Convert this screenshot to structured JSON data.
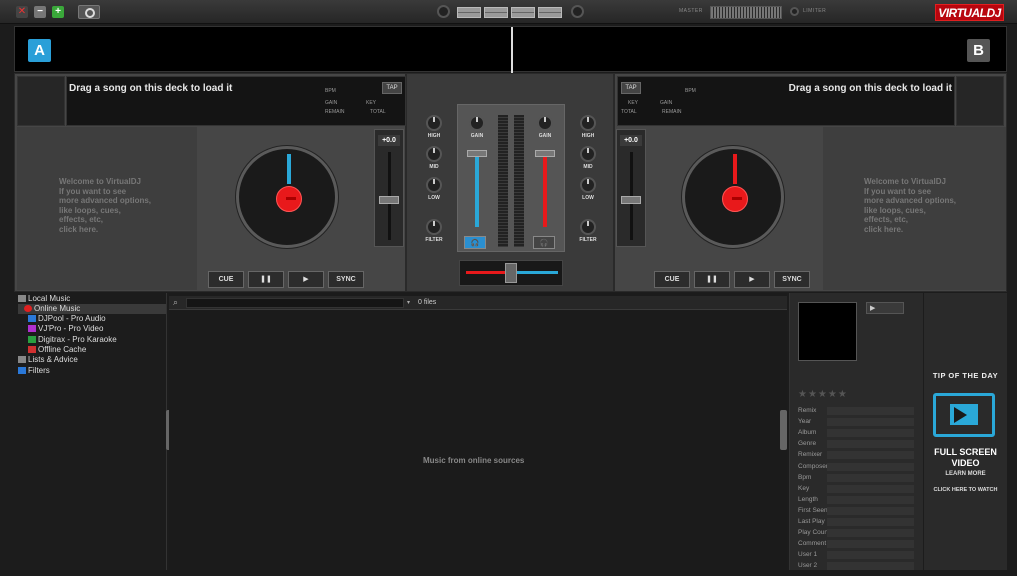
{
  "topbar": {
    "master_label": "MASTER",
    "limiter_label": "LIMITER",
    "logo": "VIRTUALDJ",
    "close_glyph": "✕",
    "min_glyph": "−",
    "max_glyph": "+"
  },
  "deck_a": {
    "letter": "A",
    "title": "Drag a song on this deck to load it",
    "bpm_label": "BPM",
    "gain_label": "GAIN",
    "key_label": "KEY",
    "remain_label": "REMAIN",
    "total_label": "TOTAL",
    "tap_label": "TAP",
    "welcome": "Welcome to VirtualDJ\nIf you want to see\nmore advanced options,\nlike loops, cues,\neffects, etc,\nclick here.",
    "pitch": "+0.0",
    "cue": "CUE",
    "play_pause": "❚❚",
    "play": "▶",
    "sync": "SYNC",
    "color": "#2aa8d8"
  },
  "deck_b": {
    "letter": "B",
    "title": "Drag a song on this deck to load it",
    "bpm_label": "BPM",
    "gain_label": "GAIN",
    "key_label": "KEY",
    "remain_label": "REMAIN",
    "total_label": "TOTAL",
    "tap_label": "TAP",
    "welcome": "Welcome to VirtualDJ\nIf you want to see\nmore advanced options,\nlike loops, cues,\neffects, etc,\nclick here.",
    "pitch": "+0.0",
    "cue": "CUE",
    "play_pause": "❚❚",
    "play": "▶",
    "sync": "SYNC",
    "color": "#e8191b"
  },
  "mixer": {
    "high": "HIGH",
    "mid": "MID",
    "low": "LOW",
    "filter": "FILTER",
    "gain": "GAIN",
    "headphone": "🎧"
  },
  "folders": [
    {
      "label": "Local Music",
      "color": "#888"
    },
    {
      "label": "Online Music",
      "color": "#e02020"
    },
    {
      "label": "DJPool - Pro Audio",
      "color": "#2a78d8"
    },
    {
      "label": "VJ'Pro - Pro Video",
      "color": "#b030d0"
    },
    {
      "label": "Digitrax - Pro Karaoke",
      "color": "#2aa040"
    },
    {
      "label": "Offline Cache",
      "color": "#d03030"
    },
    {
      "label": "Lists & Advice",
      "color": "#888"
    },
    {
      "label": "Filters",
      "color": "#2a78d8"
    }
  ],
  "browser": {
    "file_count": "0 files",
    "empty_message": "Music from online sources"
  },
  "info_fields": [
    "Remix",
    "Year",
    "Album",
    "Genre",
    "Remixer",
    "Composer",
    "Bpm",
    "Key",
    "Length",
    "First Seen",
    "Last Play",
    "Play Count",
    "Comment",
    "User 1",
    "User 2"
  ],
  "stars": "★★★★★",
  "tip": {
    "title": "TIP OF THE DAY",
    "line1": "FULL SCREEN",
    "line2": "VIDEO",
    "line3": "LEARN MORE",
    "line4": "CLICK HERE TO WATCH"
  }
}
